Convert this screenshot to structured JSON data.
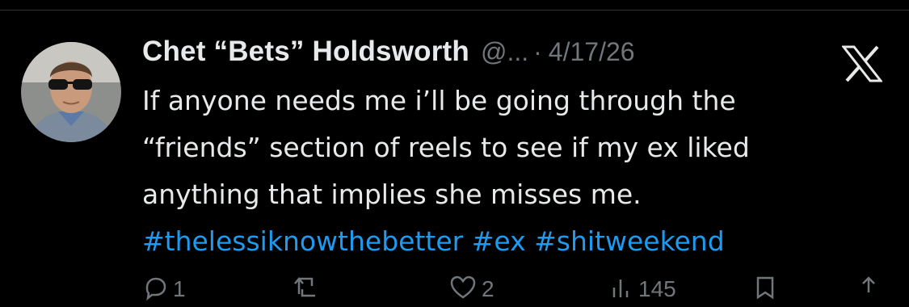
{
  "post": {
    "display_name": "Chet “Bets” Holdsworth",
    "handle": "@...",
    "separator": "·",
    "date": "4/17/26",
    "text_lines": [
      "If anyone needs me i’ll be going through the",
      "“friends” section of reels to see if my ex liked",
      "anything that implies she misses me."
    ],
    "hashtags": [
      "#thelessiknowthebetter",
      "#ex",
      "#shitweekend"
    ]
  },
  "actions": {
    "reply_count": "1",
    "like_count": "2",
    "view_count": "145"
  },
  "icons": {
    "brand": "x-logo-icon",
    "reply": "reply-icon",
    "repost": "repost-icon",
    "like": "like-icon",
    "views": "views-icon",
    "bookmark": "bookmark-icon",
    "share": "share-icon"
  },
  "colors": {
    "background": "#000000",
    "text": "#e7e9ea",
    "muted": "#71767b",
    "hashtag": "#1d9bf0"
  }
}
